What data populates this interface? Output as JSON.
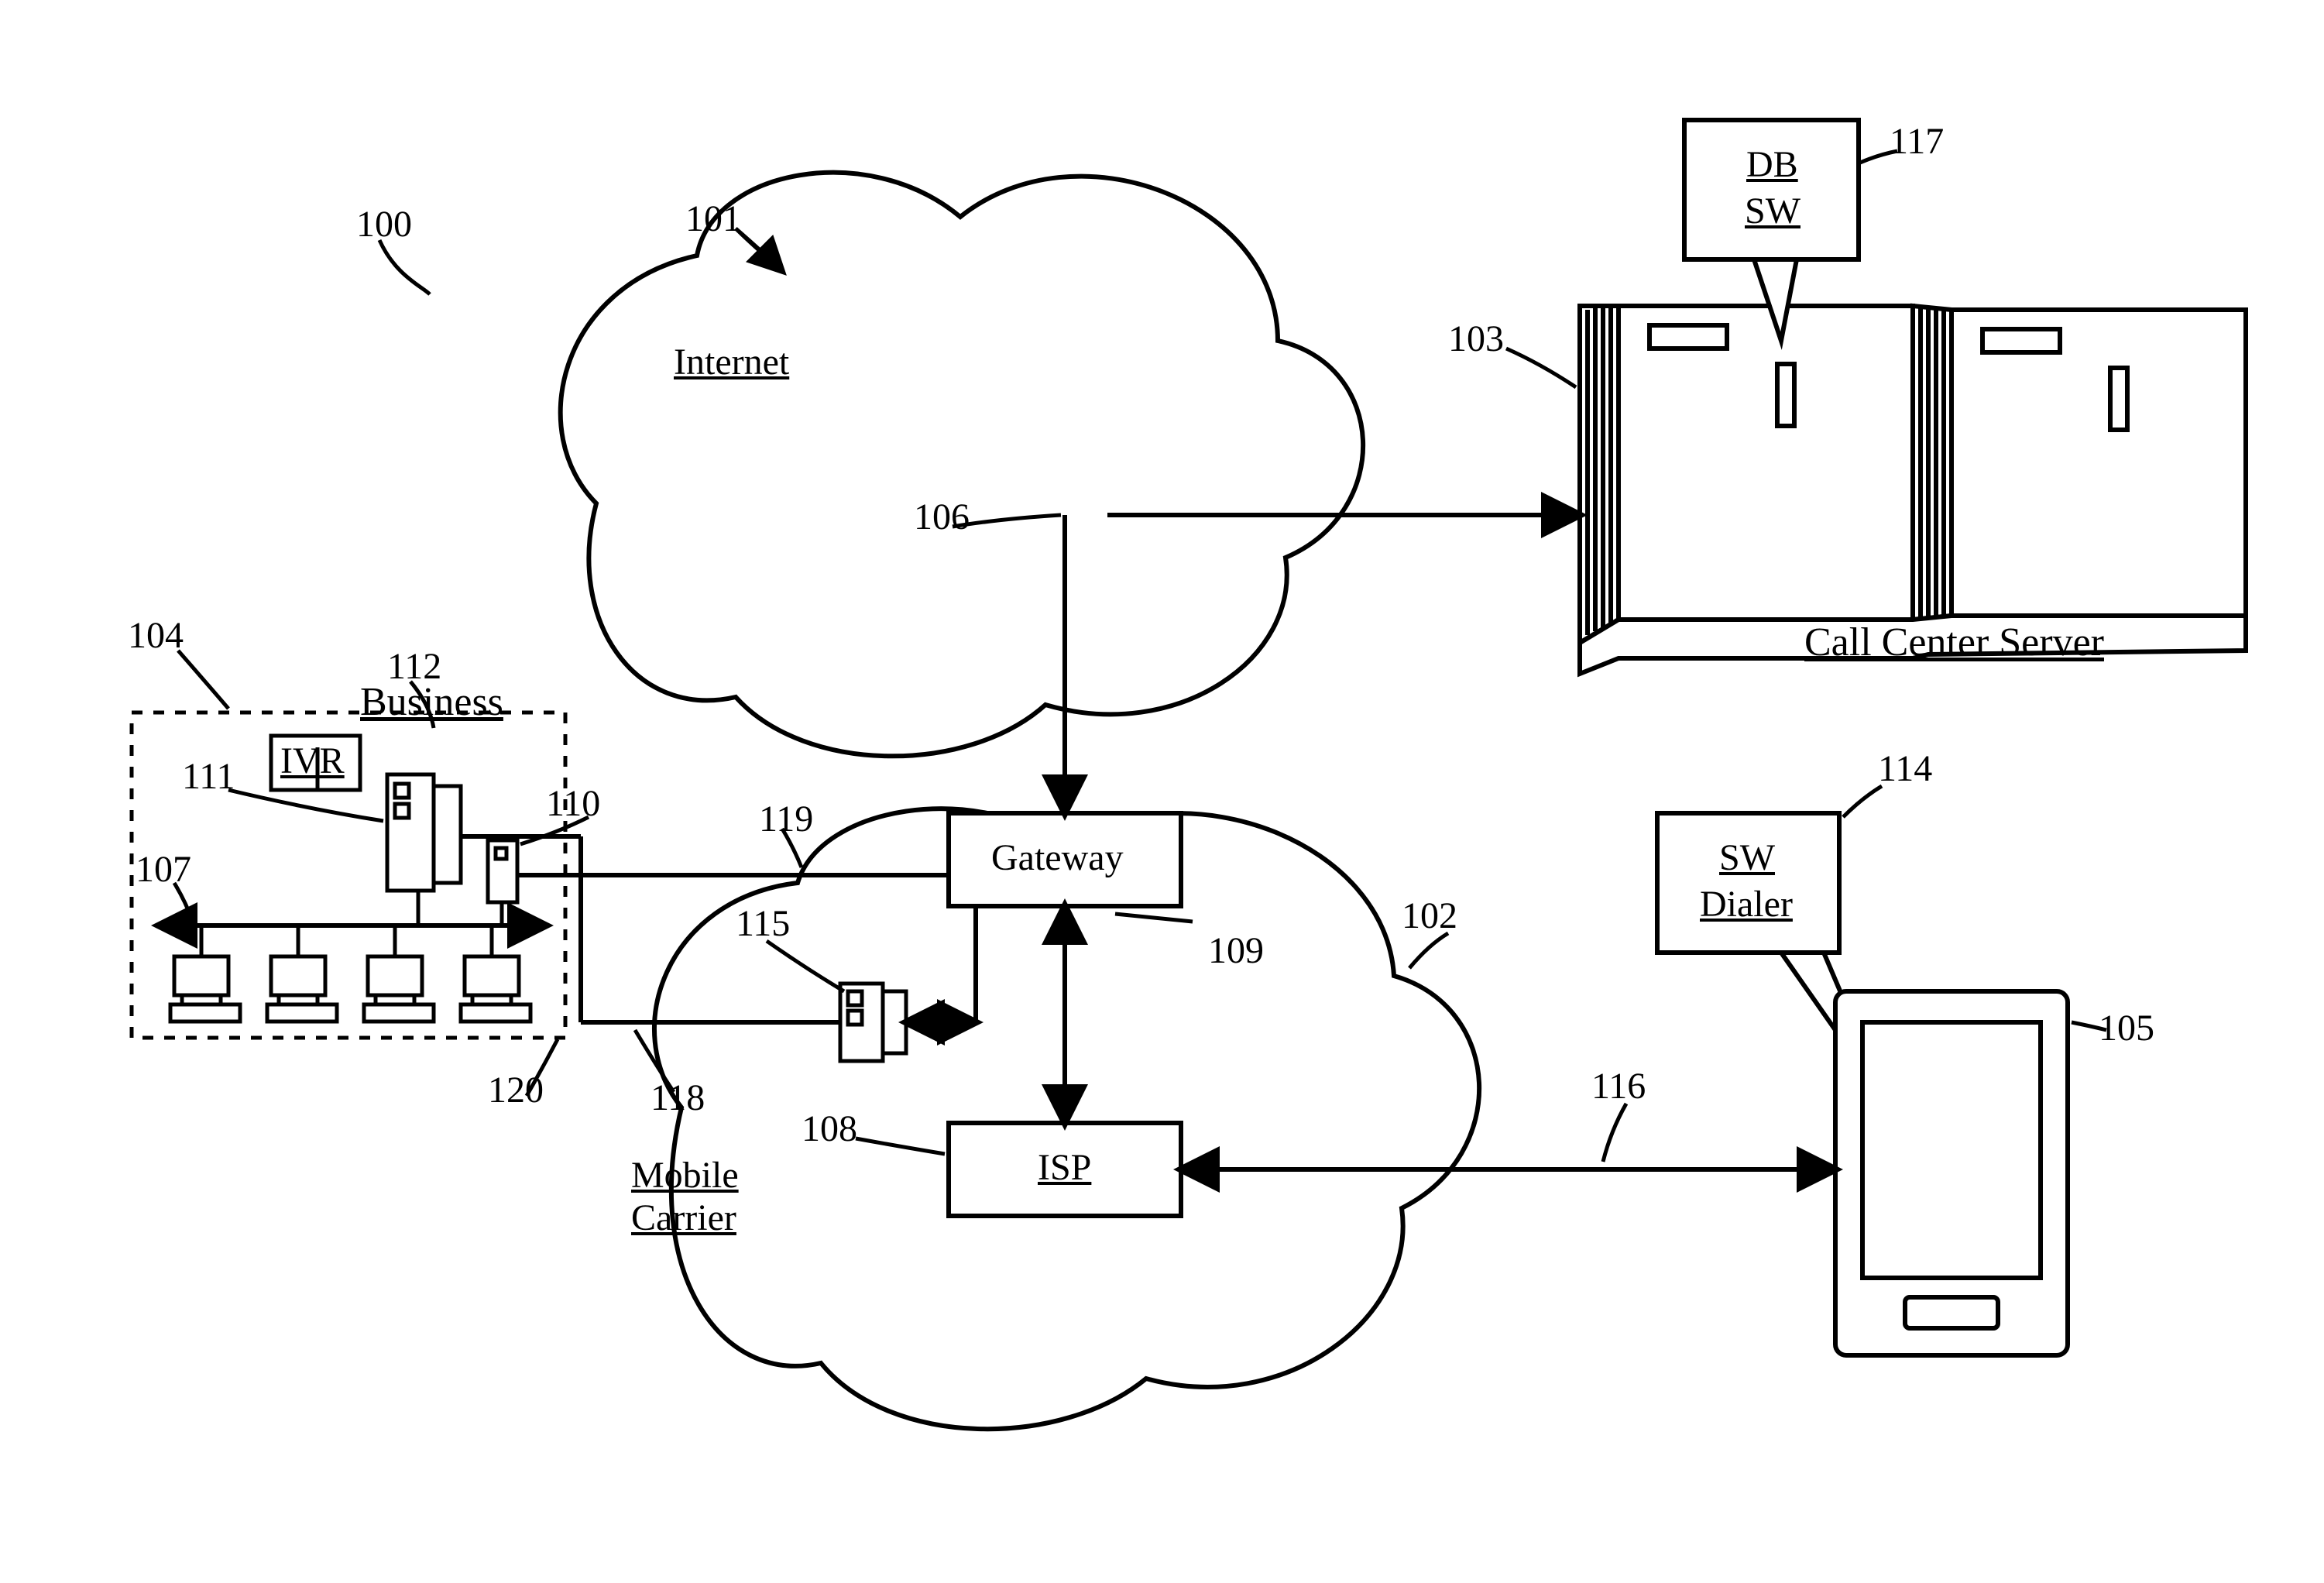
{
  "refs": {
    "r100": "100",
    "r101": "101",
    "r102": "102",
    "r103": "103",
    "r104": "104",
    "r105": "105",
    "r106": "106",
    "r107": "107",
    "r108": "108",
    "r109": "109",
    "r110": "110",
    "r111": "111",
    "r112": "112",
    "r114": "114",
    "r115": "115",
    "r116": "116",
    "r117": "117",
    "r118": "118",
    "r119": "119",
    "r120": "120"
  },
  "nodes": {
    "internet": "Internet",
    "mobileCarrier_l1": "Mobile",
    "mobileCarrier_l2": "Carrier",
    "gateway": "Gateway",
    "isp": "ISP",
    "business": "Business",
    "ivr": "IVR",
    "callCenter": "Call Center Server",
    "dbsw_l1": "DB",
    "dbsw_l2": "SW",
    "swDialer_l1": "SW",
    "swDialer_l2": "Dialer"
  }
}
